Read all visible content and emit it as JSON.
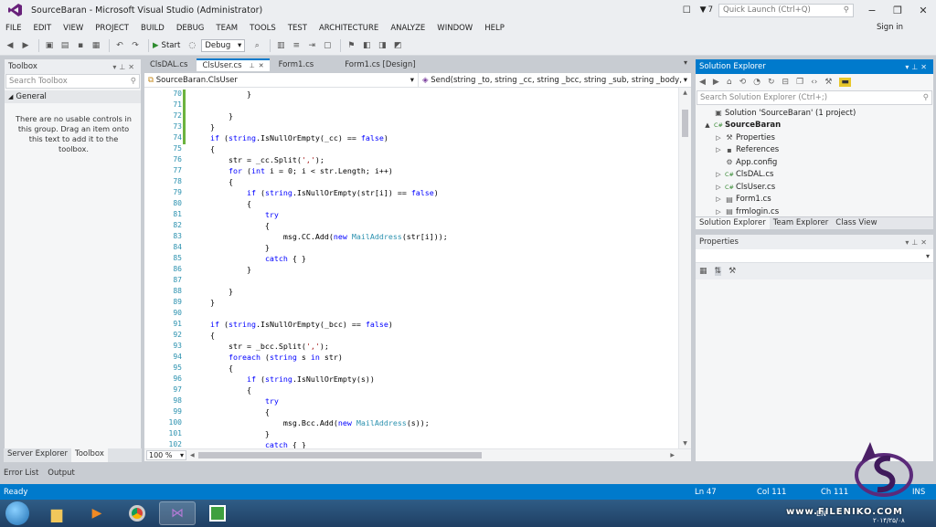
{
  "window": {
    "title": "SourceBaran - Microsoft Visual Studio (Administrator)",
    "notifications": "7",
    "quick_launch_placeholder": "Quick Launch (Ctrl+Q)"
  },
  "menu": {
    "items": [
      "FILE",
      "EDIT",
      "VIEW",
      "PROJECT",
      "BUILD",
      "DEBUG",
      "TEAM",
      "TOOLS",
      "TEST",
      "ARCHITECTURE",
      "ANALYZE",
      "WINDOW",
      "HELP"
    ],
    "sign_in": "Sign in"
  },
  "toolbar": {
    "start_label": "Start",
    "config": "Debug"
  },
  "toolbox": {
    "title": "Toolbox",
    "search_placeholder": "Search Toolbox",
    "group": "General",
    "message": "There are no usable controls in this group. Drag an item onto this text to add it to the toolbox.",
    "bottom_tabs": [
      "Server Explorer",
      "Toolbox"
    ]
  },
  "doc_tabs": [
    "ClsDAL.cs",
    "ClsUser.cs",
    "Form1.cs",
    "Form1.cs [Design]"
  ],
  "nav": {
    "class": "SourceBaran.ClsUser",
    "member": "Send(string _to, string _cc, string _bcc, string _sub, string _body, strin"
  },
  "editor": {
    "lines": [
      {
        "n": "70",
        "t": "            }"
      },
      {
        "n": "71",
        "t": ""
      },
      {
        "n": "72",
        "t": "        }"
      },
      {
        "n": "73",
        "t": "    }"
      },
      {
        "n": "74",
        "t": "    if (string.IsNullOrEmpty(_cc) == false)"
      },
      {
        "n": "75",
        "t": "    {"
      },
      {
        "n": "76",
        "t": "        str = _cc.Split(',');"
      },
      {
        "n": "77",
        "t": "        for (int i = 0; i < str.Length; i++)"
      },
      {
        "n": "78",
        "t": "        {"
      },
      {
        "n": "79",
        "t": "            if (string.IsNullOrEmpty(str[i]) == false)"
      },
      {
        "n": "80",
        "t": "            {"
      },
      {
        "n": "81",
        "t": "                try"
      },
      {
        "n": "82",
        "t": "                {"
      },
      {
        "n": "83",
        "t": "                    msg.CC.Add(new MailAddress(str[i]));"
      },
      {
        "n": "84",
        "t": "                }"
      },
      {
        "n": "85",
        "t": "                catch { }"
      },
      {
        "n": "86",
        "t": "            }"
      },
      {
        "n": "87",
        "t": ""
      },
      {
        "n": "88",
        "t": "        }"
      },
      {
        "n": "89",
        "t": "    }"
      },
      {
        "n": "90",
        "t": ""
      },
      {
        "n": "91",
        "t": "    if (string.IsNullOrEmpty(_bcc) == false)"
      },
      {
        "n": "92",
        "t": "    {"
      },
      {
        "n": "93",
        "t": "        str = _bcc.Split(',');"
      },
      {
        "n": "94",
        "t": "        foreach (string s in str)"
      },
      {
        "n": "95",
        "t": "        {"
      },
      {
        "n": "96",
        "t": "            if (string.IsNullOrEmpty(s))"
      },
      {
        "n": "97",
        "t": "            {"
      },
      {
        "n": "98",
        "t": "                try"
      },
      {
        "n": "99",
        "t": "                {"
      },
      {
        "n": "100",
        "t": "                    msg.Bcc.Add(new MailAddress(s));"
      },
      {
        "n": "101",
        "t": "                }"
      },
      {
        "n": "102",
        "t": "                catch { }"
      }
    ],
    "zoom": "100 %"
  },
  "solution_explorer": {
    "title": "Solution Explorer",
    "search_placeholder": "Search Solution Explorer (Ctrl+;)",
    "items": [
      {
        "label": "Solution 'SourceBaran' (1 project)",
        "depth": 0,
        "icon": "solution-icon",
        "expander": ""
      },
      {
        "label": "SourceBaran",
        "depth": 0,
        "icon": "csharp-project-icon",
        "expander": "▲",
        "bold": true
      },
      {
        "label": "Properties",
        "depth": 1,
        "icon": "wrench-icon",
        "expander": "▷"
      },
      {
        "label": "References",
        "depth": 1,
        "icon": "references-icon",
        "expander": "▷"
      },
      {
        "label": "App.config",
        "depth": 1,
        "icon": "config-icon",
        "expander": ""
      },
      {
        "label": "ClsDAL.cs",
        "depth": 1,
        "icon": "csharp-file-icon",
        "expander": "▷"
      },
      {
        "label": "ClsUser.cs",
        "depth": 1,
        "icon": "csharp-file-icon",
        "expander": "▷"
      },
      {
        "label": "Form1.cs",
        "depth": 1,
        "icon": "form-icon",
        "expander": "▷"
      },
      {
        "label": "frmlogin.cs",
        "depth": 1,
        "icon": "form-icon",
        "expander": "▷"
      }
    ],
    "tabs": [
      "Solution Explorer",
      "Team Explorer",
      "Class View"
    ]
  },
  "properties": {
    "title": "Properties"
  },
  "output_tabs": [
    "Error List",
    "Output"
  ],
  "status": {
    "ready": "Ready",
    "ln": "Ln 47",
    "col": "Col 111",
    "ch": "Ch 111",
    "ins": "INS"
  },
  "taskbar": {
    "lang": "EN",
    "watermark": "www.FILENIKO.COM",
    "date": "۲۰۱۴/۲۵/۰۸"
  },
  "colors": {
    "accent": "#007acc",
    "keyword": "#0000ff",
    "type": "#2b91af",
    "changes": "#6cb33e"
  }
}
